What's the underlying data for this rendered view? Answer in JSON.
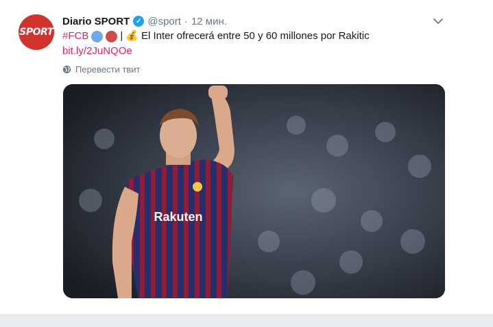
{
  "tweet": {
    "author_name": "Diario SPORT",
    "handle": "@sport",
    "separator": "·",
    "time": "12 мин.",
    "hashtag": "#FCB",
    "pipe": "|",
    "emoji": "💰",
    "text": "El Inter ofrecerá entre 50 y 60 millones por Rakitic",
    "link": "bit.ly/2JuNQOe",
    "translate_label": "Перевести твит",
    "avatar_text": "SPORT",
    "jersey_text": "Rakuten"
  },
  "colors": {
    "link": "#e0245e",
    "verified": "#1da1f2",
    "avatar_bg": "#d0342c"
  },
  "icons": {
    "verified": "verified-badge-icon",
    "caret": "chevron-down-icon",
    "globe": "globe-icon"
  }
}
